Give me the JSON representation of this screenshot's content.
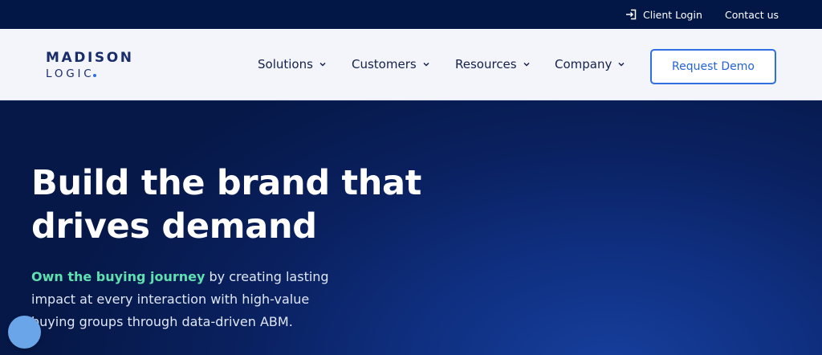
{
  "topbar": {
    "login_label": "Client Login",
    "contact_label": "Contact us"
  },
  "logo": {
    "line1": "MADISON",
    "line2": "LOGIC"
  },
  "nav": {
    "items": [
      {
        "label": "Solutions"
      },
      {
        "label": "Customers"
      },
      {
        "label": "Resources"
      },
      {
        "label": "Company"
      }
    ],
    "demo_label": "Request Demo"
  },
  "hero": {
    "title_line1": "Build the brand that",
    "title_line2": "drives demand",
    "sub_highlight": "Own the buying journey",
    "sub_rest": " by creating lasting impact at every interaction with high-value buying groups through data-driven ABM."
  },
  "colors": {
    "topbar_bg": "#031747",
    "nav_bg": "#f4f5fa",
    "accent": "#2f6fe0",
    "highlight": "#5fe0b0",
    "hero_bg": "#0f2f80"
  },
  "icons": {
    "login": "login-icon",
    "chevron": "chevron-down-icon",
    "chat": "chat-bubble-icon"
  }
}
